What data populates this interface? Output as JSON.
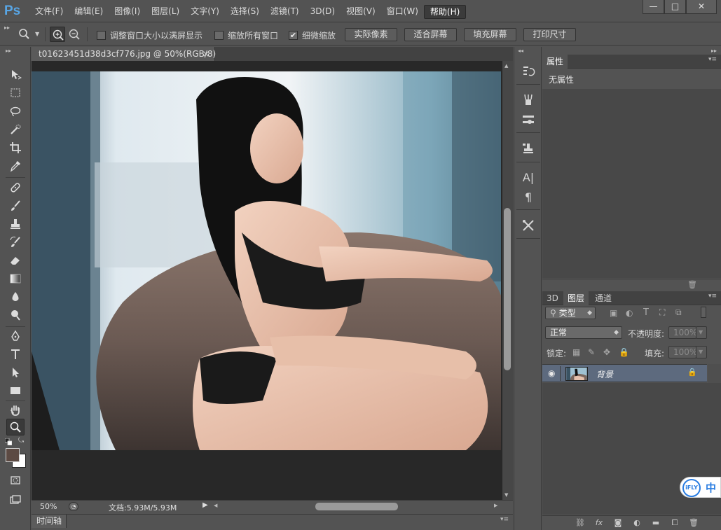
{
  "app": {
    "logo": "Ps"
  },
  "menus": [
    "文件(F)",
    "编辑(E)",
    "图像(I)",
    "图层(L)",
    "文字(Y)",
    "选择(S)",
    "滤镜(T)",
    "3D(D)",
    "视图(V)",
    "窗口(W)",
    "帮助(H)"
  ],
  "window_controls": {
    "minimize": "—",
    "maximize": "□",
    "close": "✕"
  },
  "options": {
    "resize_windows": {
      "label": "调整窗口大小以满屏显示",
      "checked": false
    },
    "zoom_all": {
      "label": "缩放所有窗口",
      "checked": false
    },
    "scrubby_zoom": {
      "label": "细微缩放",
      "checked": true,
      "mark": "✔"
    },
    "actual_pixels": "实际像素",
    "fit_screen": "适合屏幕",
    "fill_screen": "填充屏幕",
    "print_size": "打印尺寸"
  },
  "document": {
    "tab_title": "t01623451d38d3cf776.jpg @ 50%(RGB/8)",
    "close_glyph": "×",
    "zoom": "50%",
    "doc_info": "文档:5.93M/5.93M"
  },
  "timeline": {
    "label": "时间轴"
  },
  "properties": {
    "tab": "属性",
    "empty_text": "无属性"
  },
  "layers": {
    "tabs": [
      "3D",
      "图层",
      "通道"
    ],
    "active_tab_index": 1,
    "filter_kind": "类型",
    "blend_mode": "正常",
    "opacity_label": "不透明度:",
    "opacity_value": "100%",
    "lock_label": "锁定:",
    "fill_label": "填充:",
    "fill_value": "100%",
    "items": [
      {
        "name": "背景",
        "visible": true,
        "locked": true
      }
    ]
  },
  "ime": {
    "brand": "iFLY",
    "mode": "中"
  },
  "colors": {
    "panel": "#535353",
    "canvas": "#282828",
    "selected_layer": "#5d6a7e",
    "ps_blue": "#58a6e6"
  }
}
